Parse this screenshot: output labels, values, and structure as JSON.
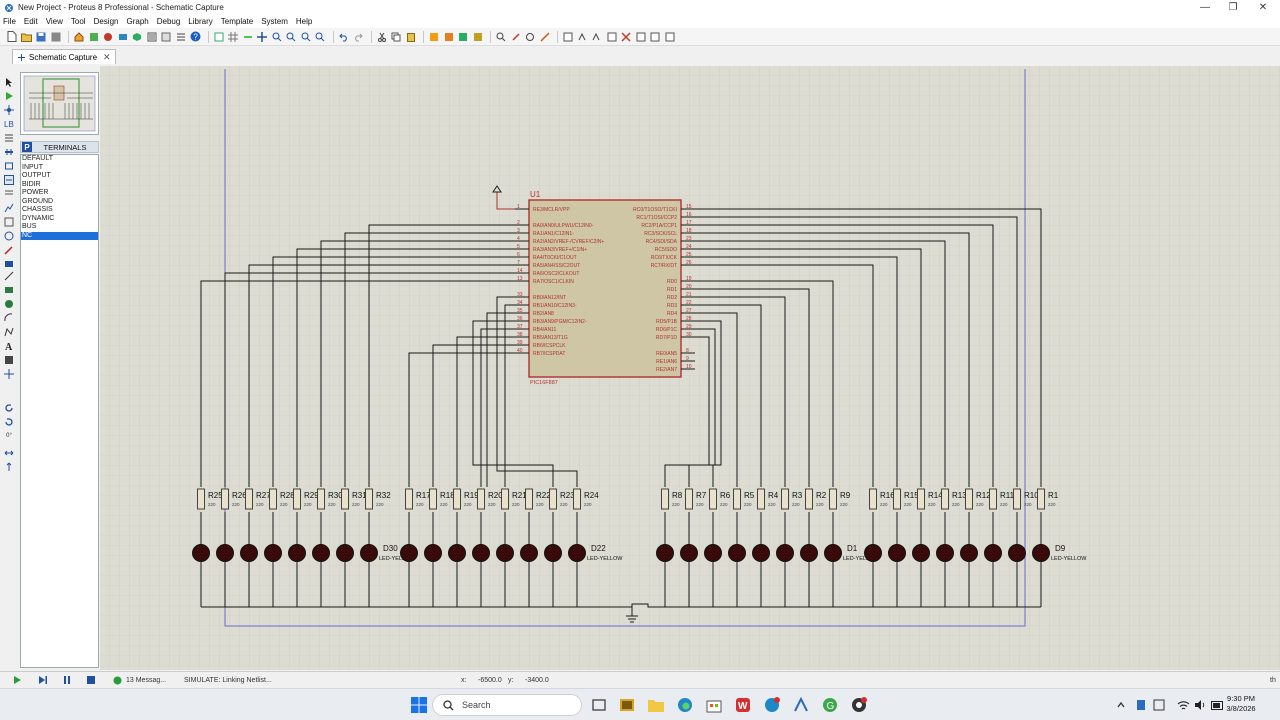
{
  "window": {
    "title": "New Project - Proteus 8 Professional - Schematic Capture",
    "min": "—",
    "max": "❐",
    "close": "✕"
  },
  "menu": [
    "File",
    "Edit",
    "View",
    "Tool",
    "Design",
    "Graph",
    "Debug",
    "Library",
    "Template",
    "System",
    "Help"
  ],
  "tab": {
    "label": "Schematic Capture",
    "close": "✕"
  },
  "panel": {
    "letter": "P",
    "title": "TERMINALS"
  },
  "terminals": [
    "DEFAULT",
    "INPUT",
    "OUTPUT",
    "BIDIR",
    "POWER",
    "GROUND",
    "CHASSIS",
    "DYNAMIC",
    "BUS",
    "NC"
  ],
  "selected_terminal": "NC",
  "rotation": "0°",
  "schematic": {
    "chip": {
      "ref": "U1",
      "part": "PIC16F887",
      "left_pins": [
        {
          "num": "1",
          "name": "RE3/MCLR/VPP"
        },
        {
          "num": "2",
          "name": "RA0/AN0/ULPWU/C12IN0-"
        },
        {
          "num": "3",
          "name": "RA1/AN1/C12IN1-"
        },
        {
          "num": "4",
          "name": "RA2/AN2/VREF-/CVREF/C2IN+"
        },
        {
          "num": "5",
          "name": "RA3/AN3/VREF+/C1IN+"
        },
        {
          "num": "6",
          "name": "RA4/T0CKI/C1OUT"
        },
        {
          "num": "7",
          "name": "RA5/AN4/SS/C2OUT"
        },
        {
          "num": "14",
          "name": "RA6/OSC2/CLKOUT"
        },
        {
          "num": "13",
          "name": "RA7/OSC1/CLKIN"
        },
        {
          "num": "33",
          "name": "RB0/AN12/INT"
        },
        {
          "num": "34",
          "name": "RB1/AN10/C12IN3-"
        },
        {
          "num": "35",
          "name": "RB2/AN8"
        },
        {
          "num": "36",
          "name": "RB3/AN9/PGM/C12IN2-"
        },
        {
          "num": "37",
          "name": "RB4/AN11"
        },
        {
          "num": "38",
          "name": "RB5/AN13/T1G"
        },
        {
          "num": "39",
          "name": "RB6/ICSPCLK"
        },
        {
          "num": "40",
          "name": "RB7/ICSPDAT"
        }
      ],
      "right_pins": [
        {
          "num": "15",
          "name": "RC0/T1OSO/T1CKI"
        },
        {
          "num": "16",
          "name": "RC1/T1OSI/CCP2"
        },
        {
          "num": "17",
          "name": "RC2/P1A/CCP1"
        },
        {
          "num": "18",
          "name": "RC3/SCK/SCL"
        },
        {
          "num": "23",
          "name": "RC4/SDI/SDA"
        },
        {
          "num": "24",
          "name": "RC5/SDO"
        },
        {
          "num": "25",
          "name": "RC6/TX/CK"
        },
        {
          "num": "26",
          "name": "RC7/RX/DT"
        },
        {
          "num": "19",
          "name": "RD0"
        },
        {
          "num": "20",
          "name": "RD1"
        },
        {
          "num": "21",
          "name": "RD2"
        },
        {
          "num": "22",
          "name": "RD3"
        },
        {
          "num": "27",
          "name": "RD4"
        },
        {
          "num": "28",
          "name": "RD5/P1B"
        },
        {
          "num": "29",
          "name": "RD6/P1C"
        },
        {
          "num": "30",
          "name": "RD7/P1D"
        },
        {
          "num": "8",
          "name": "RE0/AN5"
        },
        {
          "num": "9",
          "name": "RE1/AN6"
        },
        {
          "num": "10",
          "name": "RE2/AN7"
        }
      ]
    },
    "groups": [
      {
        "resistors": [
          "R25",
          "R26",
          "R27",
          "R28",
          "R29",
          "R30",
          "R31",
          "R32"
        ],
        "res_value": "220",
        "led_label": "D30",
        "led_type": "LED-YELLOW"
      },
      {
        "resistors": [
          "R17",
          "R18",
          "R19",
          "R20",
          "R21",
          "R22",
          "R23",
          "R24"
        ],
        "res_value": "220",
        "led_label": "D22",
        "led_type": "LED-YELLOW"
      },
      {
        "resistors": [
          "R8",
          "R7",
          "R6",
          "R5",
          "R4",
          "R3",
          "R2",
          "R9"
        ],
        "res_value": "220",
        "led_label": "D1",
        "led_type": "LED-YELLOW"
      },
      {
        "resistors": [
          "R16",
          "R15",
          "R14",
          "R13",
          "R12",
          "R11",
          "R10",
          "R1"
        ],
        "res_value": "220",
        "led_label": "D9",
        "led_type": "LED-YELLOW"
      }
    ]
  },
  "status": {
    "messages": "13 Messag...",
    "simulate": "SIMULATE: Linking Netlist...",
    "x_label": "x:",
    "x_value": "-6500.0",
    "y_label": "y:",
    "y_value": "-3400.0",
    "units": "th"
  },
  "taskbar": {
    "search": "Search",
    "time": "9:30 PM",
    "date": "3/8/2026"
  },
  "colors": {
    "wire": "#1a1a1a",
    "chip_fill": "#cfc6a6",
    "chip_border": "#b0312f",
    "pin_text": "#b0312f",
    "led": "#3a0a0a",
    "canvas": "#dcdcd2",
    "grid": "#c9c9be",
    "sheet_border": "#6a6ad0"
  }
}
